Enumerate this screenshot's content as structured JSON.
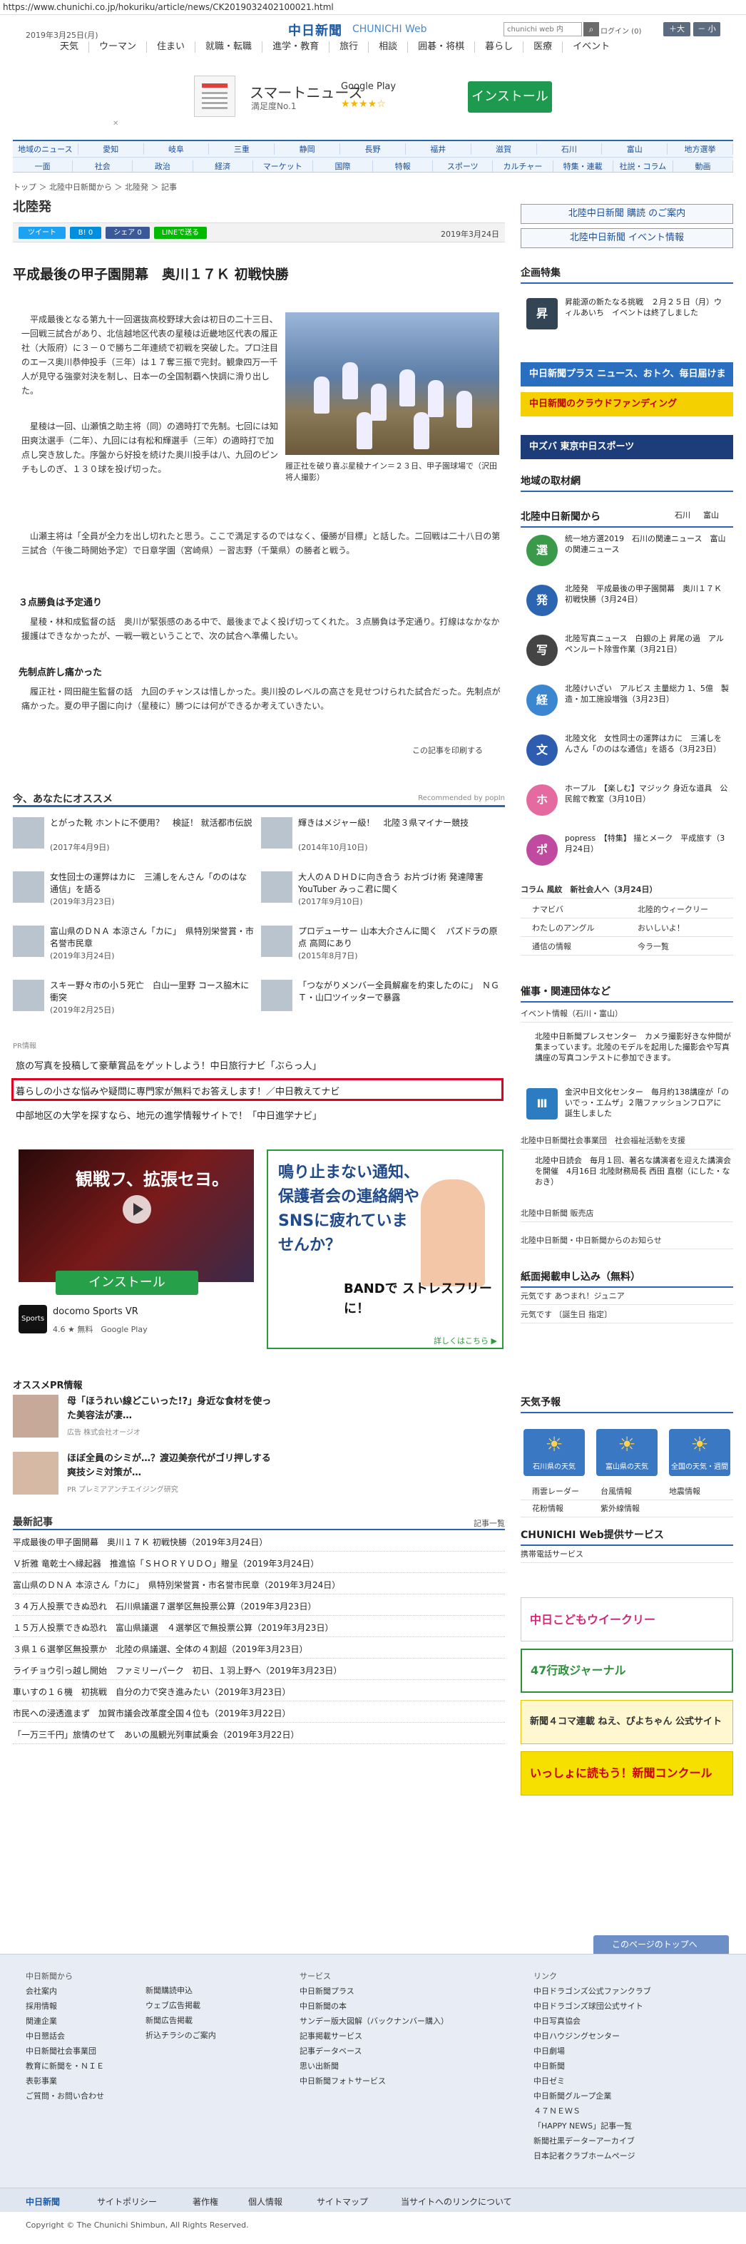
{
  "url": "https://www.chunichi.co.jp/hokuriku/article/news/CK2019032402100021.html",
  "header": {
    "date": "2019年3月25日(月)",
    "logo": "中日新聞",
    "logo_sub": "CHUNICHI Web",
    "search_placeholder": "chunichi web 内",
    "search_icon": "search-icon",
    "login": "ログイン (0)",
    "font_plus": "＋大",
    "font_minus": "－ 小"
  },
  "gnav": [
    "天気",
    "ウーマン",
    "住まい",
    "就職・転職",
    "進学・教育",
    "旅行",
    "相談",
    "囲碁・将棋",
    "暮らし",
    "医療",
    "イベント"
  ],
  "ad": {
    "title": "スマートニュース",
    "sub": "満足度No.1",
    "store": "Google Play",
    "stars": "★★★★☆",
    "install": "インストール",
    "close": "✕"
  },
  "rnav": {
    "row1": [
      "地域のニュース",
      "愛知",
      "岐阜",
      "三重",
      "静岡",
      "長野",
      "福井",
      "滋賀",
      "石川",
      "富山",
      "地方選挙"
    ],
    "row2": [
      "一面",
      "社会",
      "政治",
      "経済",
      "マーケット",
      "国際",
      "特報",
      "スポーツ",
      "カルチャー",
      "特集・連載",
      "社説・コラム",
      "動画"
    ]
  },
  "breadcrumb": "トップ ＞ 北陸中日新聞から ＞ 北陸発 ＞ 記事",
  "section_title": "北陸発",
  "share": {
    "tweet": "ツイート",
    "hatena": "B! 0",
    "fb": "シェア 0",
    "line": "LINEで送る",
    "date": "2019年3月24日"
  },
  "article": {
    "title": "平成最後の甲子園開幕　奥川１７Ｋ 初戦快勝",
    "caption": "履正社を破り喜ぶ星稜ナイン＝２３日、甲子園球場で（沢田将人撮影）",
    "p1": "平成最後となる第九十一回選抜高校野球大会は初日の二十三日、一回戦三試合があり、北信越地区代表の星稜は近畿地区代表の履正社（大阪府）に３－０で勝ち二年連続で初戦を突破した。プロ注目のエース奥川恭伸投手（三年）は１７奪三振で完封。観衆四万一千人が見守る強豪対決を制し、日本一の全国制覇へ快調に滑り出した。",
    "p2": "星稜は一回、山瀬慎之助主将（同）の適時打で先制。七回には知田爽汰選手（二年）、九回には有松和輝選手（三年）の適時打で加点し突き放した。序盤から好投を続けた奥川投手は八、九回のピンチもしのぎ、１３０球を投げ切った。",
    "p3": "山瀬主将は「全員が全力を出し切れたと思う。ここで満足するのではなく、優勝が目標」と話した。二回戦は二十八日の第三試合（午後二時開始予定）で日章学園（宮崎県）－習志野（千葉県）の勝者と戦う。",
    "h1": "３点勝負は予定通り",
    "p4": "星稜・林和成監督の話　奥川が緊張感のある中で、最後までよく投げ切ってくれた。３点勝負は予定通り。打線はなかなか援護はできなかったが、一戦一戦ということで、次の試合へ準備したい。",
    "h2": "先制点許し痛かった",
    "p5": "履正社・岡田龍生監督の話　九回のチャンスは惜しかった。奥川投のレベルの高さを見せつけられた試合だった。先制点が痛かった。夏の甲子園に向け（星稜に）勝つには何ができるか考えていきたい。",
    "print": "この記事を印刷する"
  },
  "rec": {
    "title": "今、あなたにオススメ",
    "by": "Recommended by popIn",
    "items": [
      {
        "t": "とがった靴 ホントに不便用？　検証！ 就活都市伝説",
        "d": "(2017年4月9日)"
      },
      {
        "t": "輝きはメジャー級！　北陸３県マイナー競技",
        "d": "(2014年10月10日)"
      },
      {
        "t": "女性回士の運弊はカに　三浦しをんさん「ののはな通信」を語る",
        "d": "(2019年3月23日)"
      },
      {
        "t": "大人のＡＤＨＤに向き合う お片づけ術 発達障害YouTuber みっこ君に聞く",
        "d": "(2017年9月10日)"
      },
      {
        "t": "富山県のＤＮＡ 本涼さん「カに」　県特別栄誉賞・市名誉市民章",
        "d": "(2019年3月24日)"
      },
      {
        "t": "プロデューサー 山本大介さんに聞く　パズドラの原点 高岡にあり",
        "d": "(2015年8月7日)"
      },
      {
        "t": "スキー野々市の小５死亡　白山一里野 コース脇木に衝突",
        "d": "(2019年2月25日)"
      },
      {
        "t": "「つながりメンバー全員解雇を約束したのに」　ＮＧＴ・山口ツイッターで暴露",
        "d": ""
      }
    ]
  },
  "pr": {
    "label": "PR情報",
    "l1": "旅の写真を投稿して豪華賞品をゲットしよう！中日旅行ナビ「ぶらっ人」",
    "l2": "暮らしの小さな悩みや疑問に専門家が無料でお答えします！／中日教えてナビ",
    "l3": "中部地区の大学を探すなら、地元の進学情報サイトで！「中日進学ナビ」"
  },
  "ad2": {
    "vid": "観戦フ、拡張セヨ。",
    "brand": "docomo Sports VR",
    "install": "インストール",
    "name": "docomo Sports VR",
    "rate": "4.6 ★ 無料　Google Play",
    "logo": "Sports VR"
  },
  "ad3": {
    "t": "鳴り止まない通知、保護者会の連絡網やSNSに疲れていませんか？",
    "band": "BANDで ストレスフリーに！",
    "more": "詳しくはこちら ▶"
  },
  "ospr": {
    "title": "オススメPR情報",
    "i1": "母「ほうれい線どこいった!?」身近な食材を使った美容法が凄…",
    "i1s": "広告 株式会社オージオ",
    "i2": "ほぼ全員のシミが…？渡辺美奈代がゴリ押しする爽技シミ対策が…",
    "i2s": "PR プレミアアンチエイジング研究"
  },
  "latest": {
    "title": "最新記事",
    "more": "記事一覧",
    "items": [
      "平成最後の甲子園開幕　奥川１７Ｋ 初戦快勝（2019年3月24日）",
      "Ｖ折雅 竜乾士へ縁起器　推進協「ＳＨＯＲＹＵＤＯ」贈呈（2019年3月24日）",
      "富山県のＤＮＡ 本涼さん「カに」　県特別栄誉賞・市名誉市民章（2019年3月24日）",
      "３４万人投票できぬ恐れ　石川県議選７選挙区無投票公算（2019年3月23日）",
      "１５万人投票できぬ恐れ　富山県議選　４選挙区で無投票公算（2019年3月23日）",
      "３県１６選挙区無投票か　北陸の県議選、全体の４割超（2019年3月23日）",
      "ライチョウ引っ越し開始　ファミリーパーク　初日、１羽上野へ（2019年3月23日）",
      "車いすの１６機　初挑戦　自分の力で突き進みたい（2019年3月23日）",
      "市民への浸透進まず　加賀市議会改革度全国４位も（2019年3月22日）",
      "「一万三千円」旅情のせて　あいの風観光列車試乗会（2019年3月22日）"
    ]
  },
  "side": {
    "subscribe": "北陸中日新聞 購読 のご案内",
    "event": "北陸中日新聞 イベント情報",
    "kikaku": "企画特集",
    "kikaku_item": "昇能源の新たなる挑戦　２月２５日（月）ウィルあいち　イベントは終了しました",
    "b1": "中日新聞プラス ニュース、おトク、毎日届けます",
    "b2": "中日新聞のクラウドファンディング",
    "b3": "中ズバ 東京中日スポーツ",
    "local": "地域の取材網",
    "hokuriku": "北陸中日新聞から",
    "tab_ishikawa": "石川",
    "tab_toyama": "富山",
    "items": [
      {
        "t": "統一地方選2019　石川の関連ニュース　富山の関連ニュース",
        "icon": "選"
      },
      {
        "t": "北陸発　平成最後の甲子園開幕　奥川１７Ｋ 初戦快勝（3月24日）",
        "icon": "発"
      },
      {
        "t": "北陸写真ニュース　白銀の上 昇尾の過　アルペンルート除雪作業（3月21日）",
        "icon": "写"
      },
      {
        "t": "北陸けいざい　アルビス 主量総力 1、5億　製造・加工施設増強（3月23日）",
        "icon": "経"
      },
      {
        "t": "北陸文化　女性同士の運弊はカに　三浦しをんさん「ののはな通信」を語る（3月23日）",
        "icon": "文"
      },
      {
        "t": "ホープル　【楽しむ】マジック 身近な道具　公民館で教室（3月10日）",
        "icon": "ホ"
      },
      {
        "t": "popress　【特集】 描とメーク　平成旅す（3月24日）",
        "icon": "ポ"
      }
    ],
    "column": "コラム 風紋　新社会人へ（3月24日）",
    "links1": [
      "ナマビバ",
      "北陸的ウィークリー",
      "わたしのアングル",
      "おいしいよ！",
      "通信の情報",
      "今ラ一覧"
    ],
    "events_h": "催事・関連団体など",
    "events_item": "イベント情報（石川・富山）",
    "pr_center": "北陸中日新聞プレスセンター　カメラ撮影好きな仲間が集まっています。北陸のモデルを起用した撮影会や写真講座の写真コンテストに参加できます。",
    "kanazawa": "金沢中日文化センター　毎月約138講座が「のいでっ・エムザ」２階ファッションフロアに誕生しました",
    "fund": "北陸中日新聞社会事業団　社会福祉活動を支援",
    "bunko": "北陸中日読会　毎月１回、著名な講演者を迎えた講演会を開催　4月16日 北陸財務局長 西田 直樹（にした・なおき）",
    "bunko2": "北陸中日新聞 販売店",
    "oshirase": "北陸中日新聞・中日新聞からのお知らせ",
    "paper_h": "紙面掲載申し込み（無料）",
    "paper1": "元気です  あつまれ！ジュニア",
    "paper2": "元気です  〔誕生日 指定〕",
    "weather_h": "天気予報",
    "weather": [
      {
        "l": "石川県の天気"
      },
      {
        "l": "富山県の天気"
      },
      {
        "l": "全国の天気・週間"
      }
    ],
    "wlinks": [
      "雨雲レーダー",
      "台風情報",
      "地震情報",
      "花粉情報",
      "紫外線情報"
    ],
    "svc_h": "CHUNICHI Web提供サービス",
    "svc1": "携帯電話サービス",
    "bn1": "中日こどもウイークリー",
    "bn2": "47行政ジャーナル",
    "bn3": "新聞４コマ連載 ねえ、ぴよちゃん 公式サイト",
    "bn4": "いっしょに読もう！新聞コンクール"
  },
  "totop": "このページのトップへ",
  "footer": {
    "c1_h": "中日新聞から",
    "c1": [
      "会社案内",
      "採用情報",
      "関連企業",
      "中日懇話会",
      "中日新聞社会事業団",
      "教育に新聞を・ＮＩＥ",
      "表彰事業",
      "ご質問・お問い合わせ"
    ],
    "c2": [
      "新聞購読申込",
      "ウェブ広告掲載",
      "新聞広告掲載",
      "折込チラシのご案内"
    ],
    "c3_h": "サービス",
    "c3": [
      "中日新聞プラス",
      "中日新聞の本",
      "サンデー版大図解（バックナンバー購入）",
      "記事掲載サービス",
      "記事データベース",
      "思い出新聞",
      "中日新聞フォトサービス"
    ],
    "c4_h": "リンク",
    "c4": [
      "中日ドラゴンズ公式ファンクラブ",
      "中日ドラゴンズ球団公式サイト",
      "中日写真協会",
      "中日ハウジングセンター",
      "中日劇場",
      "中日新聞",
      "中日ゼミ",
      "中日新聞グループ企業",
      "４７ＮＥＷＳ",
      "「HAPPY NEWS」記事一覧",
      "新聞社黒データーアーカイブ",
      "日本記者クラブホームページ"
    ],
    "bot": [
      "中日新聞",
      "サイトポリシー",
      "著作権",
      "個人情報",
      "サイトマップ",
      "当サイトへのリンクについて"
    ],
    "copy": "Copyright © The Chunichi Shimbun, All Rights Reserved."
  }
}
